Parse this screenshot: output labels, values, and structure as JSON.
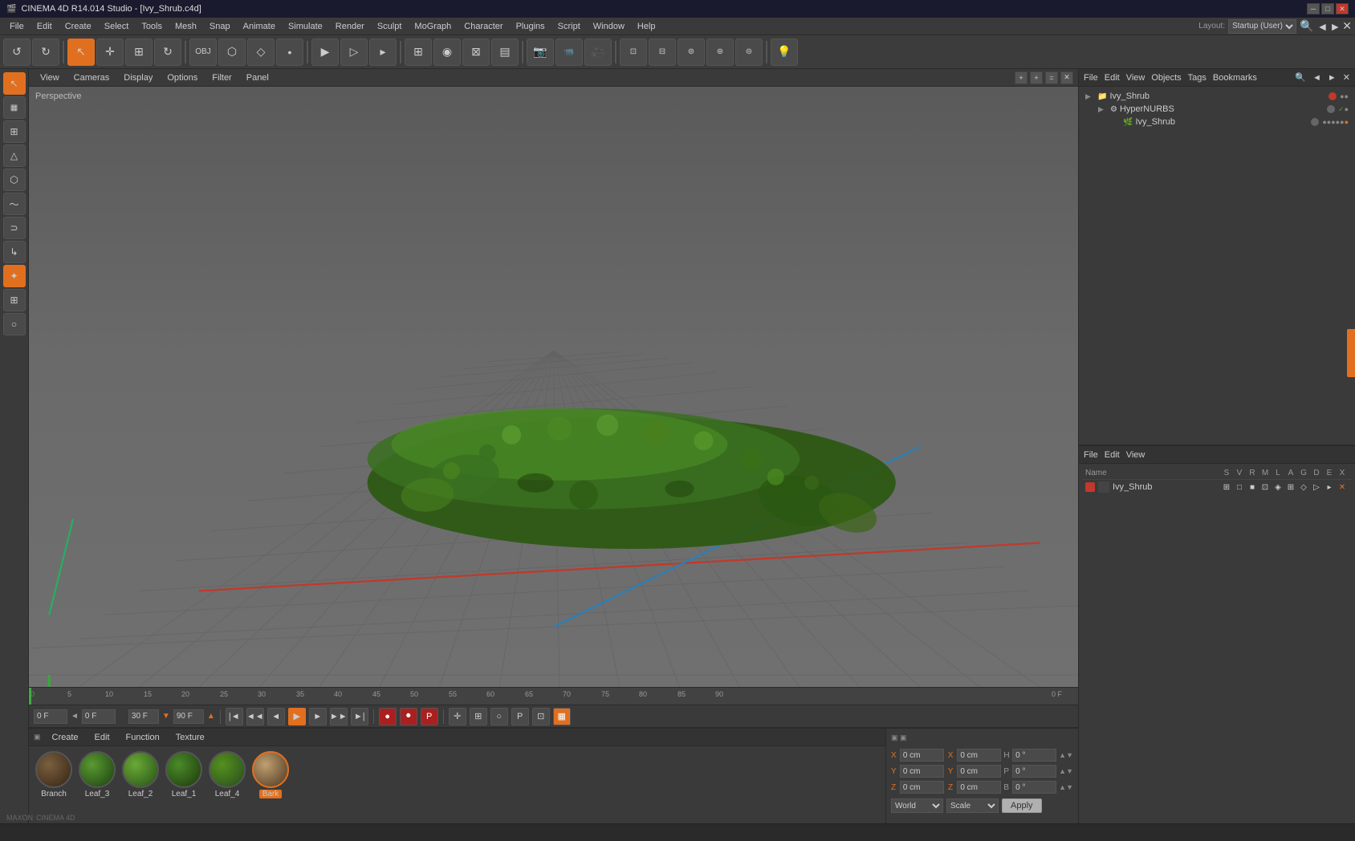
{
  "titlebar": {
    "title": "CINEMA 4D R14.014 Studio - [Ivy_Shrub.c4d]",
    "icon": "C4D",
    "controls": [
      "minimize",
      "maximize",
      "close"
    ]
  },
  "menubar": {
    "items": [
      "File",
      "Edit",
      "Create",
      "Select",
      "Tools",
      "Mesh",
      "Snap",
      "Animate",
      "Simulate",
      "Render",
      "Sculpt",
      "MoGraph",
      "Character",
      "Plugins",
      "Script",
      "Window",
      "Help"
    ]
  },
  "toolbar": {
    "left_tools": [
      "undo",
      "redo"
    ],
    "mode_tools": [
      "move",
      "scale",
      "rotate",
      "select",
      "translate_x",
      "translate_y",
      "translate_z"
    ],
    "object_tools": [
      "object_mode",
      "poly_mode",
      "edge_mode",
      "point_mode"
    ],
    "render_tools": [
      "render",
      "render_region",
      "render_active"
    ],
    "display_tools": [
      "display_grid",
      "display_shaded",
      "display_wireframe"
    ],
    "layout": "Startup (User)"
  },
  "left_panel": {
    "tools": [
      "select_arrow",
      "checkerboard",
      "grid_tool",
      "triangle",
      "polygon_obj",
      "spline",
      "nurbs",
      "bend_deform",
      "texture_paint",
      "lock_grid",
      "circle_select"
    ]
  },
  "viewport": {
    "label": "Perspective",
    "menus": [
      "View",
      "Cameras",
      "Display",
      "Options",
      "Filter",
      "Panel"
    ],
    "actions": [
      "+",
      "+",
      "=",
      "x"
    ]
  },
  "object_manager": {
    "header_menus": [
      "File",
      "Edit",
      "View",
      "Objects",
      "Tags",
      "Bookmarks"
    ],
    "objects": [
      {
        "name": "Ivy_Shrub",
        "level": 0,
        "dot_color": "red",
        "has_expand": true
      },
      {
        "name": "HyperNURBS",
        "level": 1,
        "dot_color": "gray",
        "has_expand": true,
        "checkmark": true
      },
      {
        "name": "Ivy_Shrub",
        "level": 2,
        "dot_color": "gray",
        "has_expand": false,
        "has_icon": true
      }
    ]
  },
  "attributes_manager": {
    "header_menus": [
      "File",
      "Edit",
      "View"
    ],
    "columns": [
      "Name",
      "S",
      "V",
      "R",
      "M",
      "L",
      "A",
      "G",
      "D",
      "E",
      "X"
    ],
    "row": {
      "name": "Ivy_Shrub",
      "icon_color": "red",
      "values": [
        "S",
        "V",
        "R",
        "M",
        "L",
        "A",
        "G",
        "D",
        "E",
        "X"
      ]
    }
  },
  "timeline": {
    "marks": [
      0,
      5,
      10,
      15,
      20,
      25,
      30,
      35,
      40,
      45,
      50,
      55,
      60,
      65,
      70,
      75,
      80,
      85,
      90
    ],
    "current_frame": "0 F",
    "end_frame": "90 F",
    "fps": "30 F"
  },
  "playback": {
    "current_frame": "0 F",
    "preview_frame": "0 F",
    "fps": "30 F",
    "end_frame": "90 F",
    "buttons": [
      "go_start",
      "prev_key",
      "prev_frame",
      "play",
      "next_frame",
      "next_key",
      "go_end"
    ],
    "right_buttons": [
      "record_active",
      "record_all",
      "record_pos",
      "record_scale",
      "record_rot",
      "autokey",
      "timeline"
    ]
  },
  "material_manager": {
    "menus": [
      "Create",
      "Edit",
      "Function",
      "Texture"
    ],
    "materials": [
      {
        "name": "Branch",
        "selected": false,
        "color": "#4a3520",
        "highlight_color": "#6a5030",
        "sphere_type": "branch"
      },
      {
        "name": "Leaf_3",
        "selected": false,
        "color": "#2d5a1b",
        "highlight_color": "#3d7a2b",
        "sphere_type": "leaf"
      },
      {
        "name": "Leaf_2",
        "selected": false,
        "color": "#3a6a20",
        "highlight_color": "#4a8a30",
        "sphere_type": "leaf"
      },
      {
        "name": "Leaf_1",
        "selected": false,
        "color": "#2a5015",
        "highlight_color": "#3a7025",
        "sphere_type": "leaf"
      },
      {
        "name": "Leaf_4",
        "selected": false,
        "color": "#35601e",
        "highlight_color": "#45802e",
        "sphere_type": "leaf"
      },
      {
        "name": "Bark",
        "selected": true,
        "color": "#7a6040",
        "highlight_color": "#9a8060",
        "sphere_type": "bark"
      }
    ]
  },
  "coordinates": {
    "x_pos": "0 cm",
    "y_pos": "0 cm",
    "z_pos": "0 cm",
    "x_rot": "0 °",
    "y_rot": "0 °",
    "z_rot": "0 °",
    "x_scale": "0 cm",
    "y_scale": "0 cm",
    "z_scale": "0 cm",
    "h_val": "0 °",
    "p_val": "0 °",
    "b_val": "0 °",
    "coord_system": "World",
    "transform_mode": "Scale",
    "apply_label": "Apply"
  },
  "status_bar": {
    "text": ""
  }
}
